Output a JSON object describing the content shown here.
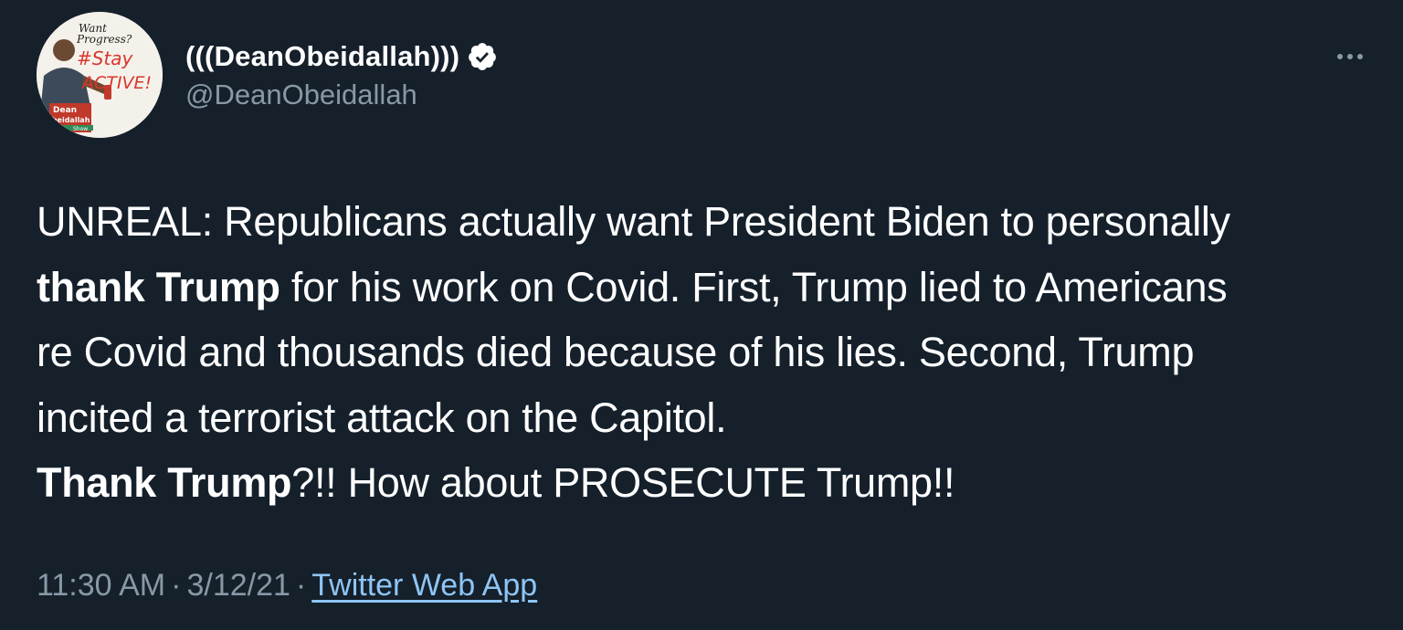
{
  "author": {
    "display_name": "(((DeanObeidallah)))",
    "handle": "@DeanObeidallah",
    "verified": true,
    "avatar_text": {
      "want": "Want",
      "progress": "Progress?",
      "stay": "#Stay",
      "active": "ACTIVE!",
      "dean": "Dean",
      "obeidallah": "Obeidallah",
      "show": "Show"
    }
  },
  "tweet": {
    "line1": "UNREAL: Republicans actually want President Biden to personally",
    "bold1": "thank Trump",
    "line2_rest": " for his work on Covid. First, Trump lied to Americans",
    "line3": "re Covid and thousands died because of his lies. Second, Trump",
    "line4": "incited a terrorist attack on the Capitol.",
    "bold2": "Thank Trump",
    "line5_rest": "?!! How about PROSECUTE Trump!!"
  },
  "meta": {
    "time": "11:30 AM",
    "date": "3/12/21",
    "separator": "·",
    "source": "Twitter Web App"
  },
  "icons": {
    "verified": "verified-badge-icon",
    "more": "more-options-icon"
  },
  "colors": {
    "background": "#15202b",
    "secondary_text": "#8899a6",
    "link": "#8ec5f5"
  }
}
